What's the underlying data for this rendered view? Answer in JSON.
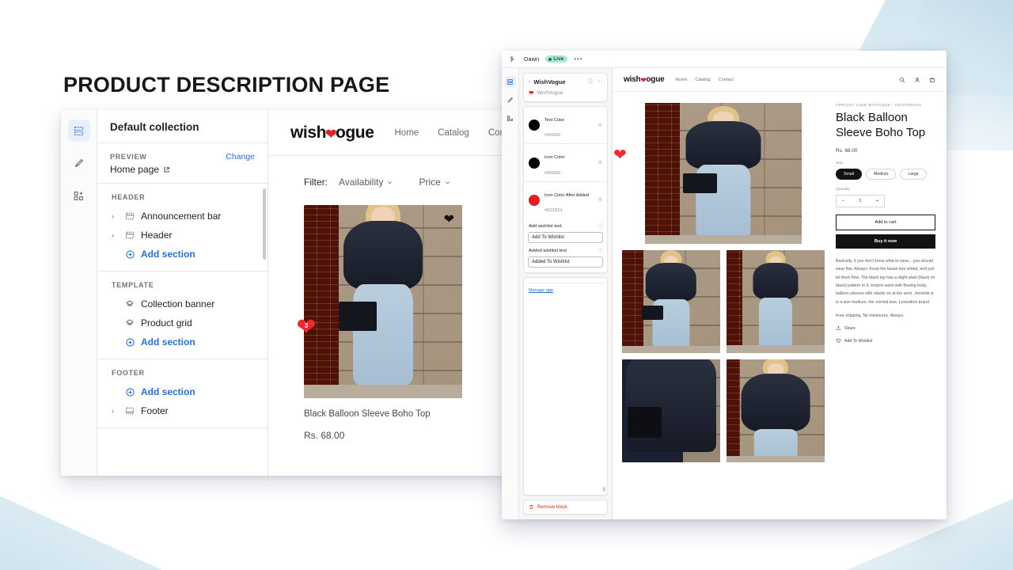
{
  "page_title": "PRODUCT DESCRIPTION PAGE",
  "theme_editor": {
    "panel_title": "Default collection",
    "preview_label": "PREVIEW",
    "change_link": "Change",
    "preview_page": "Home page",
    "rail_icons": [
      "sections-icon",
      "brush-icon",
      "apps-icon"
    ],
    "groups": [
      {
        "heading": "HEADER",
        "items": [
          {
            "label": "Announcement bar",
            "icon": "section-icon",
            "expandable": true,
            "add": false
          },
          {
            "label": "Header",
            "icon": "section-icon",
            "expandable": true,
            "add": false
          },
          {
            "label": "Add section",
            "icon": "plus-circle-icon",
            "expandable": false,
            "add": true
          }
        ]
      },
      {
        "heading": "TEMPLATE",
        "items": [
          {
            "label": "Collection banner",
            "icon": "layers-icon",
            "expandable": false,
            "add": false
          },
          {
            "label": "Product grid",
            "icon": "layers-icon",
            "expandable": false,
            "add": false
          },
          {
            "label": "Add section",
            "icon": "plus-circle-icon",
            "expandable": false,
            "add": true
          }
        ]
      },
      {
        "heading": "FOOTER",
        "items": [
          {
            "label": "Add section",
            "icon": "plus-circle-icon",
            "expandable": false,
            "add": true
          },
          {
            "label": "Footer",
            "icon": "footer-icon",
            "expandable": true,
            "add": false
          }
        ]
      }
    ]
  },
  "collection_preview": {
    "logo": {
      "pre": "wish",
      "heart": "heart-icon",
      "post": "ogue"
    },
    "nav": [
      "Home",
      "Catalog",
      "Con"
    ],
    "filter_label": "Filter:",
    "filter_options": [
      "Availability",
      "Price"
    ],
    "product": {
      "title": "Black Balloon Sleeve Boho Top",
      "price": "Rs. 68.00"
    },
    "wishlist_badge_count": "3"
  },
  "app_editor": {
    "topbar": {
      "theme_name": "Dawn",
      "status_badge": "Live",
      "menu": "•••"
    },
    "block": {
      "title": "WishVogue",
      "app_name": "WishVogue",
      "settings": [
        {
          "name": "Text Color",
          "hex": "#000000",
          "swatch": "#000000"
        },
        {
          "name": "Icon Color",
          "hex": "#000000",
          "swatch": "#000000"
        },
        {
          "name": "Icon Color After Added",
          "hex": "#ED1B24",
          "swatch": "#ED1B24"
        }
      ],
      "fields": [
        {
          "label": "Add wishlist text",
          "value": "Add To Wishlist"
        },
        {
          "label": "Added wishlist text",
          "value": "Added To Wishlist"
        }
      ],
      "manage_app": "Manage app",
      "remove_block": "Remove block"
    }
  },
  "product_page": {
    "logo": {
      "pre": "wish",
      "heart": "heart-icon",
      "post": "ogue"
    },
    "nav": [
      "Home",
      "Catalog",
      "Contact"
    ],
    "header_icons": [
      "search-icon",
      "account-icon",
      "cart-icon"
    ],
    "vendor": "APRICOT LANE BOUTIQUE - CENTENNIAL",
    "title": "Black Balloon Sleeve Boho Top",
    "price": "Rs. 68.00",
    "size_label": "Size",
    "sizes": [
      "Small",
      "Medium",
      "Large"
    ],
    "selected_size": "Small",
    "quantity_label": "Quantity",
    "quantity_value": "1",
    "quantity_minus": "–",
    "quantity_plus": "+",
    "add_to_cart": "Add to cart",
    "buy_it_now": "Buy it now",
    "description": "Basically, if you don't know what to wear....you should wear this. Always.  Keep the tassel ties untied, and just let them flow.  The black top has a slight plaid (black on black) pattern to it, empire waist with flowing body, balloon sleeves with elastic on at the wrist. Jennelle is is a size medium, her normal size. Lovestitch brand.",
    "shipping": "Free shipping. No minimums. Always.",
    "share": "Share",
    "wishlist": "Add To Wishlist"
  }
}
